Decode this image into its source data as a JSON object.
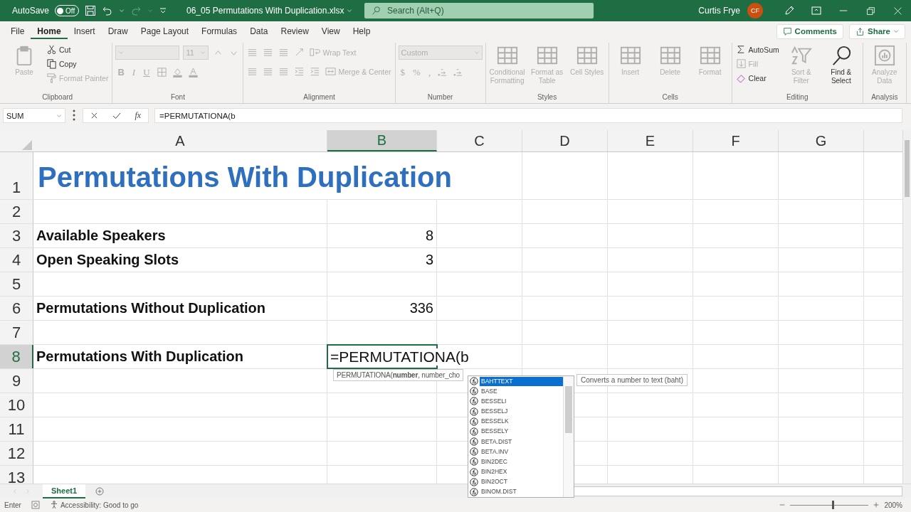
{
  "title_bar": {
    "autosave_label": "AutoSave",
    "autosave_toggle": {
      "label": "Off",
      "on": false
    },
    "filename": "06_05 Permutations With Duplication.xlsx",
    "search": {
      "placeholder": "Search (Alt+Q)"
    },
    "user_name": "Curtis Frye",
    "avatar": "CF"
  },
  "tabs": [
    {
      "label": "File",
      "selected": false
    },
    {
      "label": "Home",
      "selected": true
    },
    {
      "label": "Insert",
      "selected": false
    },
    {
      "label": "Draw",
      "selected": false
    },
    {
      "label": "Page Layout",
      "selected": false
    },
    {
      "label": "Formulas",
      "selected": false
    },
    {
      "label": "Data",
      "selected": false
    },
    {
      "label": "Review",
      "selected": false
    },
    {
      "label": "View",
      "selected": false
    },
    {
      "label": "Help",
      "selected": false
    }
  ],
  "comments_button": "Comments",
  "share_button": "Share",
  "ribbon": {
    "groups": [
      {
        "label": "Clipboard",
        "kind": "columns",
        "columns": [
          [
            {
              "kind": "paste",
              "label": "Paste",
              "disabled": true
            }
          ],
          [
            {
              "kind": "cut",
              "label": "Cut",
              "disabled": false
            },
            {
              "kind": "copy",
              "label": "Copy",
              "disabled": false
            },
            {
              "kind": "brush",
              "label": "Format Painter",
              "disabled": true
            }
          ]
        ]
      },
      {
        "label": "Font",
        "kind": "rows",
        "rows": [
          [
            {
              "kind": "font-field",
              "disabled": true
            },
            {
              "kind": "size-field",
              "value": "11",
              "disabled": true
            },
            {
              "kind": "grow",
              "disabled": true
            },
            {
              "kind": "shrink",
              "disabled": true
            }
          ],
          [
            {
              "kind": "bold",
              "label": "B",
              "disabled": true
            },
            {
              "kind": "italic",
              "label": "I",
              "disabled": true
            },
            {
              "kind": "underline",
              "label": "U",
              "disabled": true
            },
            {
              "kind": "border",
              "disabled": true
            },
            {
              "kind": "fillcolor",
              "disabled": true
            },
            {
              "kind": "fontcolor",
              "disabled": true
            }
          ]
        ]
      },
      {
        "label": "Alignment",
        "kind": "rows",
        "rows": [
          [
            {
              "kind": "lines",
              "disabled": true
            },
            {
              "kind": "lines",
              "disabled": true
            },
            {
              "kind": "lines",
              "disabled": true
            },
            {
              "kind": "orient",
              "disabled": true
            },
            {
              "kind": "wrap",
              "label": "Wrap Text",
              "disabled": true
            }
          ],
          [
            {
              "kind": "lines",
              "disabled": true
            },
            {
              "kind": "lines",
              "disabled": true
            },
            {
              "kind": "lines",
              "disabled": true
            },
            {
              "kind": "indent",
              "disabled": true
            },
            {
              "kind": "indent",
              "disabled": true
            },
            {
              "kind": "merge",
              "label": "Merge & Center",
              "disabled": true
            }
          ]
        ]
      },
      {
        "label": "Number",
        "kind": "rows",
        "rows": [
          [
            {
              "kind": "format-field",
              "value": "Custom",
              "disabled": true
            }
          ],
          [
            {
              "kind": "symbol",
              "label": "$",
              "disabled": true
            },
            {
              "kind": "symbol",
              "label": "%",
              "disabled": true
            },
            {
              "kind": "symbol",
              "label": ",",
              "disabled": true
            },
            {
              "kind": "decimal",
              "disabled": true
            },
            {
              "kind": "decimal",
              "disabled": true
            }
          ]
        ]
      },
      {
        "label": "Styles",
        "kind": "columns",
        "columns": [
          [
            {
              "kind": "table",
              "label": "Conditional Formatting",
              "disabled": true
            }
          ],
          [
            {
              "kind": "table",
              "label": "Format as Table",
              "disabled": true
            }
          ],
          [
            {
              "kind": "table",
              "label": "Cell Styles",
              "disabled": true
            }
          ]
        ]
      },
      {
        "label": "Cells",
        "kind": "columns",
        "columns": [
          [
            {
              "kind": "table",
              "label": "Insert",
              "disabled": true
            }
          ],
          [
            {
              "kind": "table",
              "label": "Delete",
              "disabled": true
            }
          ],
          [
            {
              "kind": "table",
              "label": "Format",
              "disabled": true
            }
          ]
        ]
      },
      {
        "label": "Editing",
        "kind": "columns",
        "columns": [
          [
            {
              "kind": "sigma",
              "label": "AutoSum",
              "disabled": false
            },
            {
              "kind": "filldown",
              "label": "Fill",
              "disabled": true
            },
            {
              "kind": "eraser",
              "label": "Clear",
              "disabled": false
            }
          ],
          [
            {
              "kind": "sort",
              "label": "Sort & Filter",
              "disabled": true
            }
          ],
          [
            {
              "kind": "search",
              "label": "Find & Select",
              "disabled": false
            }
          ]
        ]
      },
      {
        "label": "Analysis",
        "kind": "columns",
        "columns": [
          [
            {
              "kind": "analyze",
              "label": "Analyze Data",
              "disabled": true
            }
          ]
        ]
      }
    ]
  },
  "formula_bar": {
    "name_box": "SUM",
    "function_button": "fx",
    "formula": "=PERMUTATIONA(b"
  },
  "columns": [
    {
      "label": "A",
      "selected": false
    },
    {
      "label": "B",
      "selected": true
    },
    {
      "label": "C",
      "selected": false
    },
    {
      "label": "D",
      "selected": false
    },
    {
      "label": "E",
      "selected": false
    },
    {
      "label": "F",
      "selected": false
    },
    {
      "label": "G",
      "selected": false
    }
  ],
  "rows": [
    {
      "header": "1",
      "selected": false,
      "kind": "title",
      "a": {
        "text": "Permutations With Duplication"
      }
    },
    {
      "header": "2",
      "selected": false,
      "kind": "data"
    },
    {
      "header": "3",
      "selected": false,
      "kind": "data",
      "a": {
        "text": "Available Speakers"
      },
      "b": {
        "text": "8",
        "active": false
      }
    },
    {
      "header": "4",
      "selected": false,
      "kind": "data",
      "a": {
        "text": "Open Speaking Slots"
      },
      "b": {
        "text": "3",
        "active": false
      }
    },
    {
      "header": "5",
      "selected": false,
      "kind": "data"
    },
    {
      "header": "6",
      "selected": false,
      "kind": "data",
      "a": {
        "text": "Permutations Without Duplication"
      },
      "b": {
        "text": "336",
        "active": false
      }
    },
    {
      "header": "7",
      "selected": false,
      "kind": "data"
    },
    {
      "header": "8",
      "selected": true,
      "kind": "data",
      "a": {
        "text": "Permutations With Duplication"
      },
      "b": {
        "text": "=PERMUTATIONA(b",
        "active": true
      }
    },
    {
      "header": "9",
      "selected": false,
      "kind": "data"
    },
    {
      "header": "10",
      "selected": false,
      "kind": "data"
    },
    {
      "header": "11",
      "selected": false,
      "kind": "data"
    },
    {
      "header": "12",
      "selected": false,
      "kind": "data"
    },
    {
      "header": "13",
      "selected": false,
      "kind": "data"
    }
  ],
  "function_hint": "PERMUTATIONA(**number**, number_cho",
  "autocomplete": {
    "items": [
      {
        "label": "BAHTTEXT",
        "selected": true
      },
      {
        "label": "BASE",
        "selected": false
      },
      {
        "label": "BESSELI",
        "selected": false
      },
      {
        "label": "BESSELJ",
        "selected": false
      },
      {
        "label": "BESSELK",
        "selected": false
      },
      {
        "label": "BESSELY",
        "selected": false
      },
      {
        "label": "BETA.DIST",
        "selected": false
      },
      {
        "label": "BETA.INV",
        "selected": false
      },
      {
        "label": "BIN2DEC",
        "selected": false
      },
      {
        "label": "BIN2HEX",
        "selected": false
      },
      {
        "label": "BIN2OCT",
        "selected": false
      },
      {
        "label": "BINOM.DIST",
        "selected": false
      }
    ],
    "tooltip": "Converts a number to text (baht)"
  },
  "sheet_tabs": [
    {
      "label": "Sheet1",
      "selected": true
    }
  ],
  "status_bar": {
    "mode": "Enter",
    "accessibility": "Accessibility: Good to go",
    "zoom": {
      "level": 0.55,
      "reading": "200%"
    }
  }
}
